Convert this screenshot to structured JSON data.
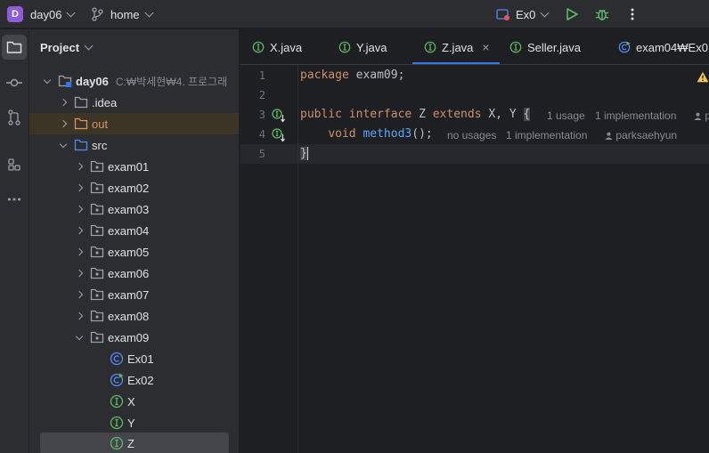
{
  "titlebar": {
    "project_badge": "D",
    "project_name": "day06",
    "branch_icon": "git-branch-icon",
    "branch_name": "home",
    "run_config": "Ex0",
    "run_icon": "play-icon",
    "debug_icon": "bug-icon",
    "more_icon": "more-vertical-icon"
  },
  "toolwindow": {
    "items": [
      "folder-icon",
      "commit-icon",
      "pull-request-icon",
      "structure-icon",
      "more-horizontal-icon"
    ]
  },
  "project_panel": {
    "title": "Project",
    "root": {
      "label": "day06",
      "path": "C:₩박세현₩4. 프로그래"
    },
    "idea": ".idea",
    "out": "out",
    "src": "src",
    "packages": [
      "exam01",
      "exam02",
      "exam03",
      "exam04",
      "exam05",
      "exam06",
      "exam07",
      "exam08",
      "exam09"
    ],
    "files": [
      {
        "label": "Ex01",
        "kind": "class"
      },
      {
        "label": "Ex02",
        "kind": "class-main"
      },
      {
        "label": "X",
        "kind": "interface"
      },
      {
        "label": "Y",
        "kind": "interface"
      },
      {
        "label": "Z",
        "kind": "interface"
      }
    ]
  },
  "tabs": [
    {
      "label": "X.java",
      "icon": "interface-icon"
    },
    {
      "label": "Y.java",
      "icon": "interface-icon"
    },
    {
      "label": "Z.java",
      "icon": "interface-icon",
      "active": true
    },
    {
      "label": "Seller.java",
      "icon": "interface-icon"
    },
    {
      "label": "exam04₩Ex0",
      "icon": "class-main-icon"
    }
  ],
  "editor": {
    "line_numbers": [
      "1",
      "2",
      "3",
      "4",
      "5"
    ],
    "line1": {
      "kw": "package",
      "rest": " exam09;"
    },
    "line3": {
      "kw1": "public",
      "kw2": "interface",
      "name": " Z ",
      "kw3": "extends",
      "rest": " X, Y ",
      "brace": "{",
      "hint_usage": "1 usage",
      "hint_impl": "1 implementation",
      "hint_author": "p"
    },
    "line4": {
      "kw": "void",
      "method": "method3",
      "rest": "();",
      "hint_usage": "no usages",
      "hint_impl": "1 implementation",
      "hint_author": "parksaehyun"
    },
    "line5": {
      "brace": "}"
    },
    "warning_icon": "warning-icon"
  },
  "colors": {
    "accent": "#3574f0",
    "interface_green": "#5fb865",
    "folder_blue": "#548af7",
    "excluded_orange": "#d5946b",
    "keyword": "#cf8e6d",
    "method": "#56a8f5"
  }
}
